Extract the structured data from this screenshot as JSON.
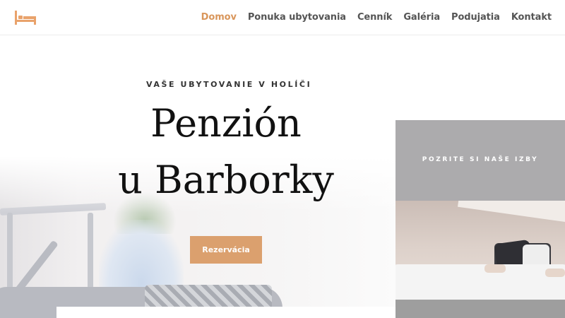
{
  "header": {
    "logo_icon": "bed-icon",
    "accent_color": "#d9965b",
    "nav": [
      {
        "label": "Domov",
        "active": true
      },
      {
        "label": "Ponuka ubytovania",
        "active": false
      },
      {
        "label": "Cenník",
        "active": false
      },
      {
        "label": "Galéria",
        "active": false
      },
      {
        "label": "Podujatia",
        "active": false
      },
      {
        "label": "Kontakt",
        "active": false
      }
    ]
  },
  "hero": {
    "subtitle": "VAŠE UBYTOVANIE V HOLÍČI",
    "title_line1": "Penzión",
    "title_line2": "u Barborky",
    "cta_label": "Rezervácia",
    "cta_color": "#dba06e"
  },
  "rooms": {
    "label": "POZRITE SI NAŠE IZBY"
  }
}
